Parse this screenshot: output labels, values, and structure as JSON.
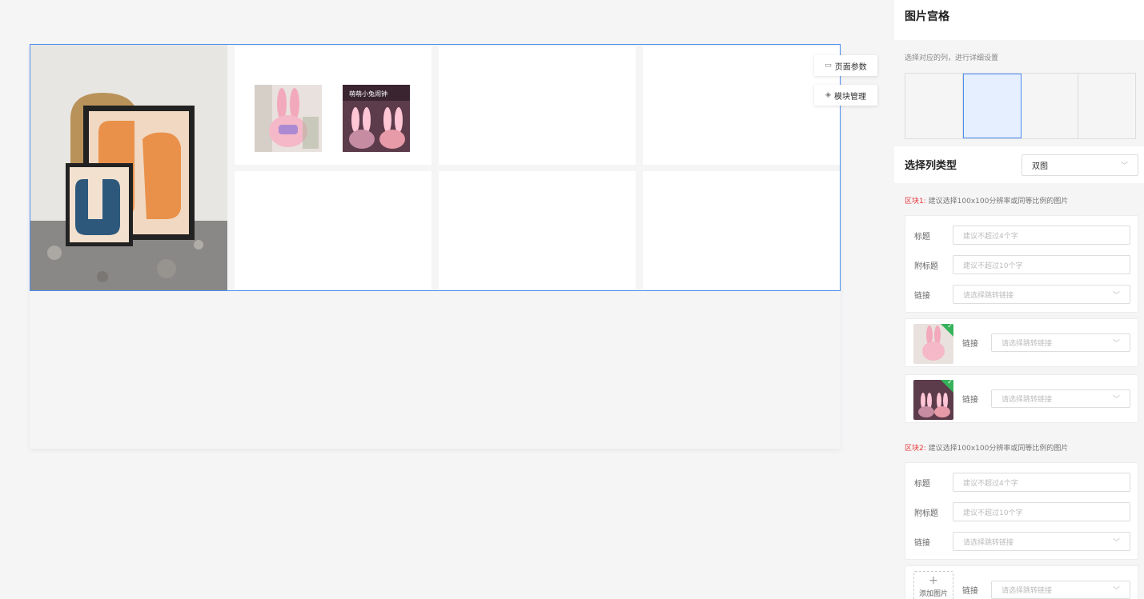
{
  "canvas": {
    "float_buttons": [
      {
        "icon": "page-icon",
        "label": "页面参数"
      },
      {
        "icon": "layers-icon",
        "label": "模块管理"
      }
    ],
    "thumb1_text": "",
    "thumb2_text": "萌萌小兔闹钟"
  },
  "panel": {
    "title": "图片宫格",
    "column_hint": "选择对应的列，进行详细设置",
    "columns": 4,
    "active_column": 2,
    "type_label": "选择列类型",
    "type_value": "双图",
    "block1": {
      "prefix": "区块1:",
      "hint": "建议选择100x100分辨率或同等比例的图片",
      "title_label": "标题",
      "title_placeholder": "建议不超过4个字",
      "subtitle_label": "附标题",
      "subtitle_placeholder": "建议不超过10个字",
      "link_label": "链接",
      "link_placeholder": "请选择跳转链接"
    },
    "images": [
      {
        "link_label": "链接",
        "link_placeholder": "请选择跳转链接"
      },
      {
        "link_label": "链接",
        "link_placeholder": "请选择跳转链接"
      }
    ],
    "block2": {
      "prefix": "区块2:",
      "hint": "建议选择100x100分辨率或同等比例的图片",
      "title_label": "标题",
      "title_placeholder": "建议不超过4个字",
      "subtitle_label": "附标题",
      "subtitle_placeholder": "建议不超过10个字",
      "link_label": "链接",
      "link_placeholder": "请选择跳转链接"
    },
    "add_image": {
      "plus": "+",
      "label": "添加图片",
      "link_label": "链接",
      "link_placeholder": "请选择跳转链接"
    }
  },
  "colors": {
    "accent": "#4a8ff0",
    "warning": "#e53a3a",
    "check": "#36b35a"
  }
}
